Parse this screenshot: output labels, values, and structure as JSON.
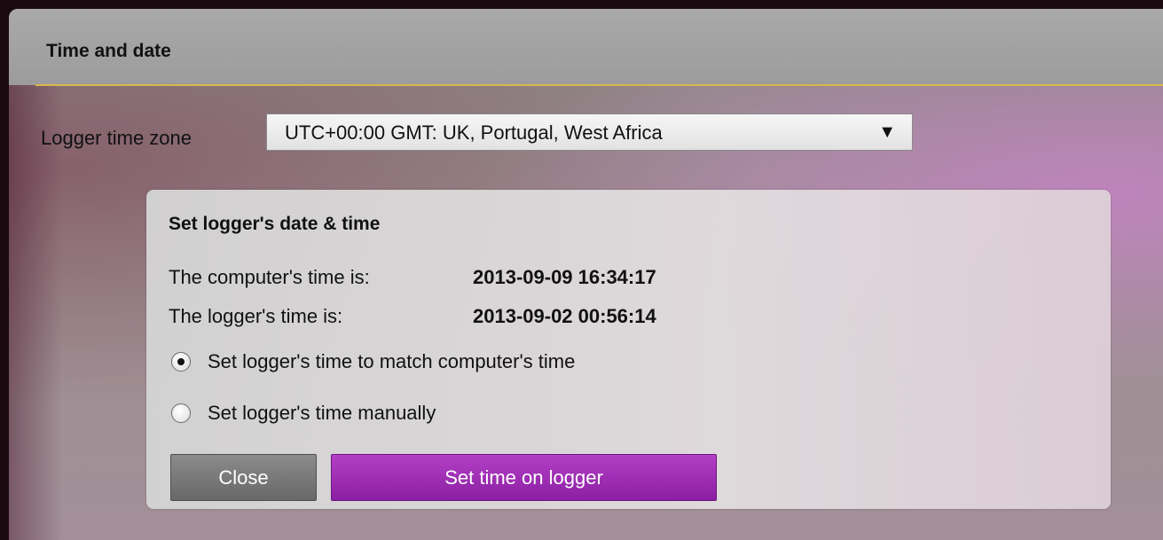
{
  "window": {
    "title": "Time and date"
  },
  "timezone": {
    "label": "Logger time zone",
    "selected": "UTC+00:00 GMT: UK, Portugal, West Africa",
    "arrow_icon": "triangle-down-icon"
  },
  "panel": {
    "title": "Set logger's date & time",
    "computer_time_label": "The computer's time is:",
    "computer_time_value": "2013-09-09 16:34:17",
    "logger_time_label": "The logger's time is:",
    "logger_time_value": "2013-09-02 00:56:14",
    "options": [
      {
        "label": "Set logger's time to match computer's time",
        "selected": true
      },
      {
        "label": "Set logger's time manually",
        "selected": false
      }
    ]
  },
  "buttons": {
    "close_label": "Close",
    "set_label": "Set time on logger"
  },
  "colors": {
    "accent_rule": "#d8b84a",
    "primary_button": "#a030b8",
    "secondary_button": "#7a7a7a"
  }
}
